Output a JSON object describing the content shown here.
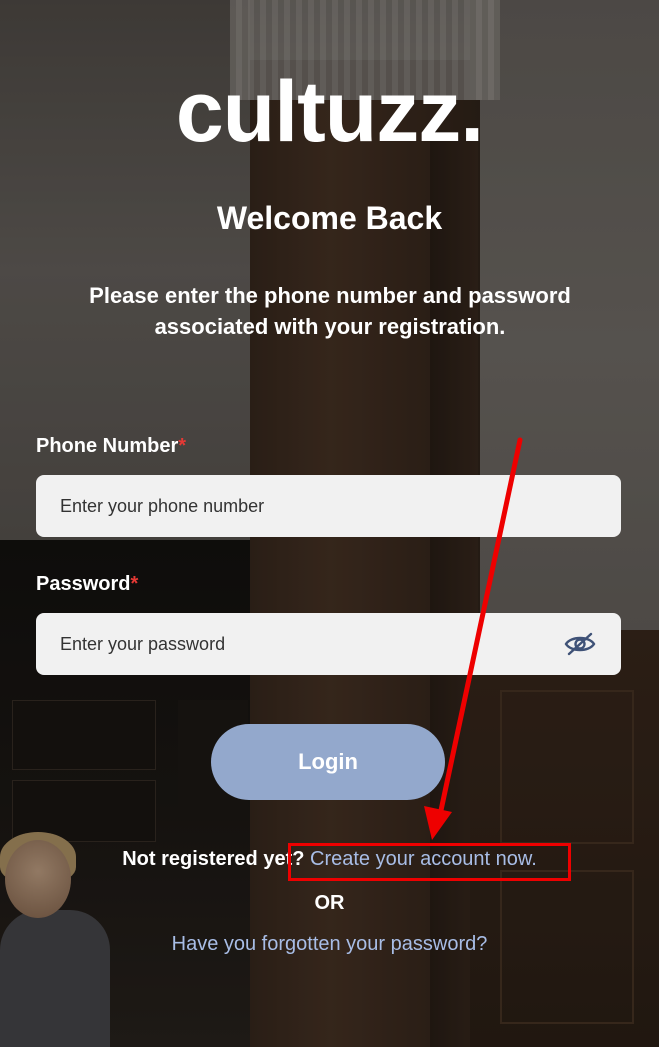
{
  "brand": {
    "logo_text": "cultuzz."
  },
  "header": {
    "title": "Welcome Back",
    "subtitle": "Please enter the phone number and password associated with your registration."
  },
  "form": {
    "phone": {
      "label": "Phone Number",
      "required_mark": "*",
      "placeholder": "Enter your phone number",
      "value": ""
    },
    "password": {
      "label": "Password",
      "required_mark": "*",
      "placeholder": "Enter your password",
      "value": "",
      "toggle_icon": "eye-slash-icon"
    },
    "login_label": "Login"
  },
  "footer": {
    "not_registered": "Not registered yet?",
    "create_account_link": "Create your account now.",
    "or_label": "OR",
    "forgot_link": "Have you forgotten your password?"
  },
  "colors": {
    "login_button": "#93a8cc",
    "link": "#a8bde6",
    "required": "#e53935",
    "annotation": "#e00000"
  }
}
